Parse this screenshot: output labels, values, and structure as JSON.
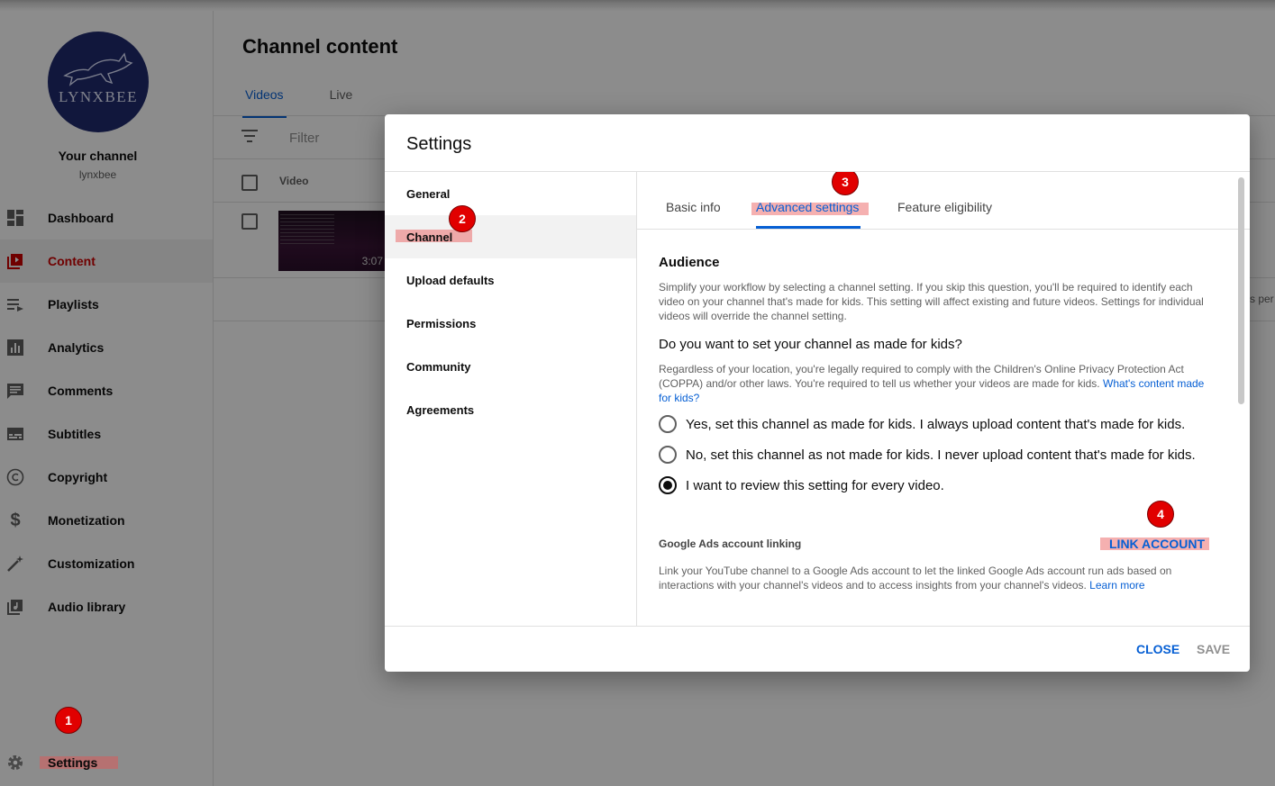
{
  "sidebar": {
    "logo_text": "LYNXBEE",
    "channel_title": "Your channel",
    "channel_handle": "lynxbee",
    "items": [
      {
        "label": "Dashboard",
        "icon": "dashboard-icon"
      },
      {
        "label": "Content",
        "icon": "content-icon",
        "active": true
      },
      {
        "label": "Playlists",
        "icon": "playlists-icon"
      },
      {
        "label": "Analytics",
        "icon": "analytics-icon"
      },
      {
        "label": "Comments",
        "icon": "comments-icon"
      },
      {
        "label": "Subtitles",
        "icon": "subtitles-icon"
      },
      {
        "label": "Copyright",
        "icon": "copyright-icon"
      },
      {
        "label": "Monetization",
        "icon": "dollar-icon"
      },
      {
        "label": "Customization",
        "icon": "magic-wand-icon"
      },
      {
        "label": "Audio library",
        "icon": "audio-library-icon"
      }
    ],
    "settings_label": "Settings"
  },
  "main": {
    "title": "Channel content",
    "tabs": [
      {
        "label": "Videos",
        "active": true
      },
      {
        "label": "Live"
      }
    ],
    "filter_placeholder": "Filter",
    "column_video": "Video",
    "video_duration": "3:07",
    "rows_per_page_fragment": "s per"
  },
  "dialog": {
    "title": "Settings",
    "nav": [
      {
        "label": "General"
      },
      {
        "label": "Channel",
        "active": true
      },
      {
        "label": "Upload defaults"
      },
      {
        "label": "Permissions"
      },
      {
        "label": "Community"
      },
      {
        "label": "Agreements"
      }
    ],
    "subtabs": [
      {
        "label": "Basic info"
      },
      {
        "label": "Advanced settings",
        "active": true
      },
      {
        "label": "Feature eligibility"
      }
    ],
    "audience": {
      "title": "Audience",
      "description": "Simplify your workflow by selecting a channel setting. If you skip this question, you'll be required to identify each video on your channel that's made for kids. This setting will affect existing and future videos. Settings for individual videos will override the channel setting.",
      "question": "Do you want to set your channel as made for kids?",
      "legal_text": "Regardless of your location, you're legally required to comply with the Children's Online Privacy Protection Act (COPPA) and/or other laws. You're required to tell us whether your videos are made for kids.",
      "legal_link": "What's content made for kids?",
      "options": [
        {
          "label": "Yes, set this channel as made for kids. I always upload content that's made for kids.",
          "checked": false
        },
        {
          "label": "No, set this channel as not made for kids. I never upload content that's made for kids.",
          "checked": false
        },
        {
          "label": "I want to review this setting for every video.",
          "checked": true
        }
      ]
    },
    "ads": {
      "title": "Google Ads account linking",
      "button": "LINK ACCOUNT",
      "description": "Link your YouTube channel to a Google Ads account to let the linked Google Ads account run ads based on interactions with your channel's videos and to access insights from your channel's videos.",
      "learn_more": "Learn more"
    },
    "buttons": {
      "close": "CLOSE",
      "save": "SAVE"
    }
  },
  "annotations": {
    "step1": "1",
    "step2": "2",
    "step3": "3",
    "step4": "4"
  },
  "colors": {
    "accent": "#065fd4",
    "active_red": "#cc0000",
    "badge_red": "#e10000",
    "highlight": "#e85050"
  }
}
